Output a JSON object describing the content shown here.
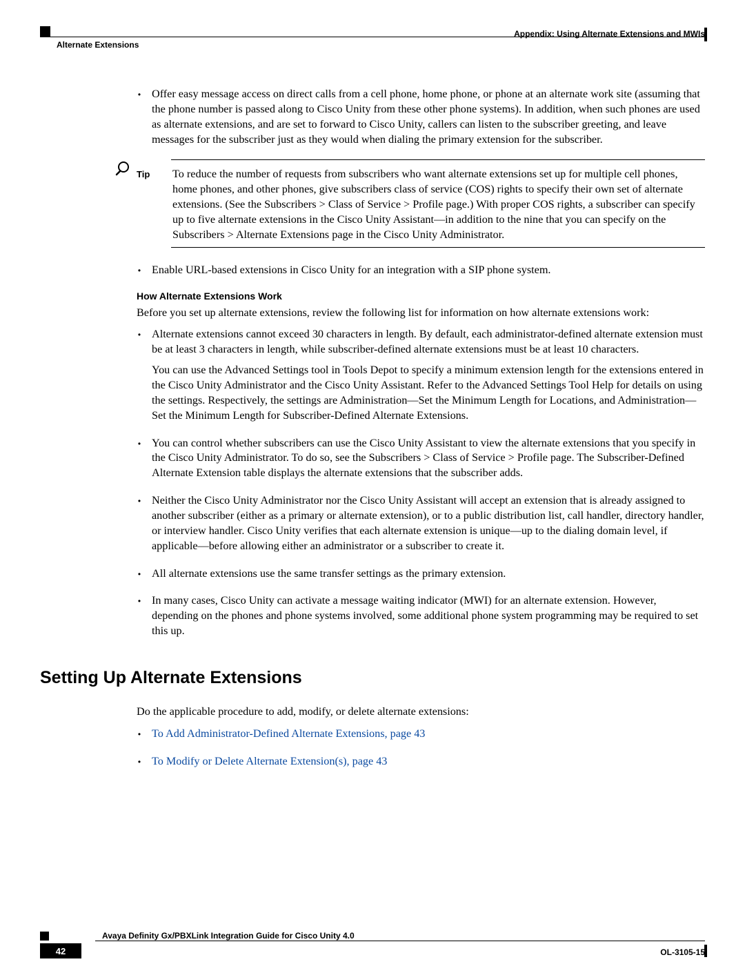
{
  "header": {
    "right": "Appendix: Using Alternate Extensions and MWIs",
    "left": "Alternate Extensions"
  },
  "bullets_top": [
    "Offer easy message access on direct calls from a cell phone, home phone, or phone at an alternate work site (assuming that the phone number is passed along to Cisco Unity from these other phone systems). In addition, when such phones are used as alternate extensions, and are set to forward to Cisco Unity, callers can listen to the subscriber greeting, and leave messages for the subscriber just as they would when dialing the primary extension for the subscriber."
  ],
  "tip": {
    "label": "Tip",
    "text": "To reduce the number of requests from subscribers who want alternate extensions set up for multiple cell phones, home phones, and other phones, give subscribers class of service (COS) rights to specify their own set of alternate extensions. (See the Subscribers > Class of Service > Profile page.) With proper COS rights, a subscriber can specify up to five alternate extensions in the Cisco Unity Assistant—in addition to the nine that you can specify on the Subscribers > Alternate Extensions page in the Cisco Unity Administrator."
  },
  "bullets_mid": [
    "Enable URL-based extensions in Cisco Unity for an integration with a SIP phone system."
  ],
  "subhead": "How Alternate Extensions Work",
  "intro_para": "Before you set up alternate extensions, review the following list for information on how alternate extensions work:",
  "how_bullets": [
    {
      "main": "Alternate extensions cannot exceed 30 characters in length. By default, each administrator-defined alternate extension must be at least 3 characters in length, while subscriber-defined alternate extensions must be at least 10 characters.",
      "sub": "You can use the Advanced Settings tool in Tools Depot to specify a minimum extension length for the extensions entered in the Cisco Unity Administrator and the Cisco Unity Assistant. Refer to the Advanced Settings Tool Help for details on using the settings. Respectively, the settings are Administration—Set the Minimum Length for Locations, and Administration—Set the Minimum Length for Subscriber-Defined Alternate Extensions."
    },
    {
      "main": "You can control whether subscribers can use the Cisco Unity Assistant to view the alternate extensions that you specify in the Cisco Unity Administrator. To do so, see the Subscribers > Class of Service > Profile page. The Subscriber-Defined Alternate Extension table displays the alternate extensions that the subscriber adds."
    },
    {
      "main": "Neither the Cisco Unity Administrator nor the Cisco Unity Assistant will accept an extension that is already assigned to another subscriber (either as a primary or alternate extension), or to a public distribution list, call handler, directory handler, or interview handler. Cisco Unity verifies that each alternate extension is unique—up to the dialing domain level, if applicable—before allowing either an administrator or a subscriber to create it."
    },
    {
      "main": "All alternate extensions use the same transfer settings as the primary extension."
    },
    {
      "main": "In many cases, Cisco Unity can activate a message waiting indicator (MWI) for an alternate extension. However, depending on the phones and phone systems involved, some additional phone system programming may be required to set this up."
    }
  ],
  "h2": "Setting Up Alternate Extensions",
  "setup_para": "Do the applicable procedure to add, modify, or delete alternate extensions:",
  "setup_links": [
    "To Add Administrator-Defined Alternate Extensions, page 43",
    "To Modify or Delete Alternate Extension(s), page 43"
  ],
  "footer": {
    "title": "Avaya Definity Gx/PBXLink Integration Guide for Cisco Unity 4.0",
    "page": "42",
    "docid": "OL-3105-15"
  }
}
